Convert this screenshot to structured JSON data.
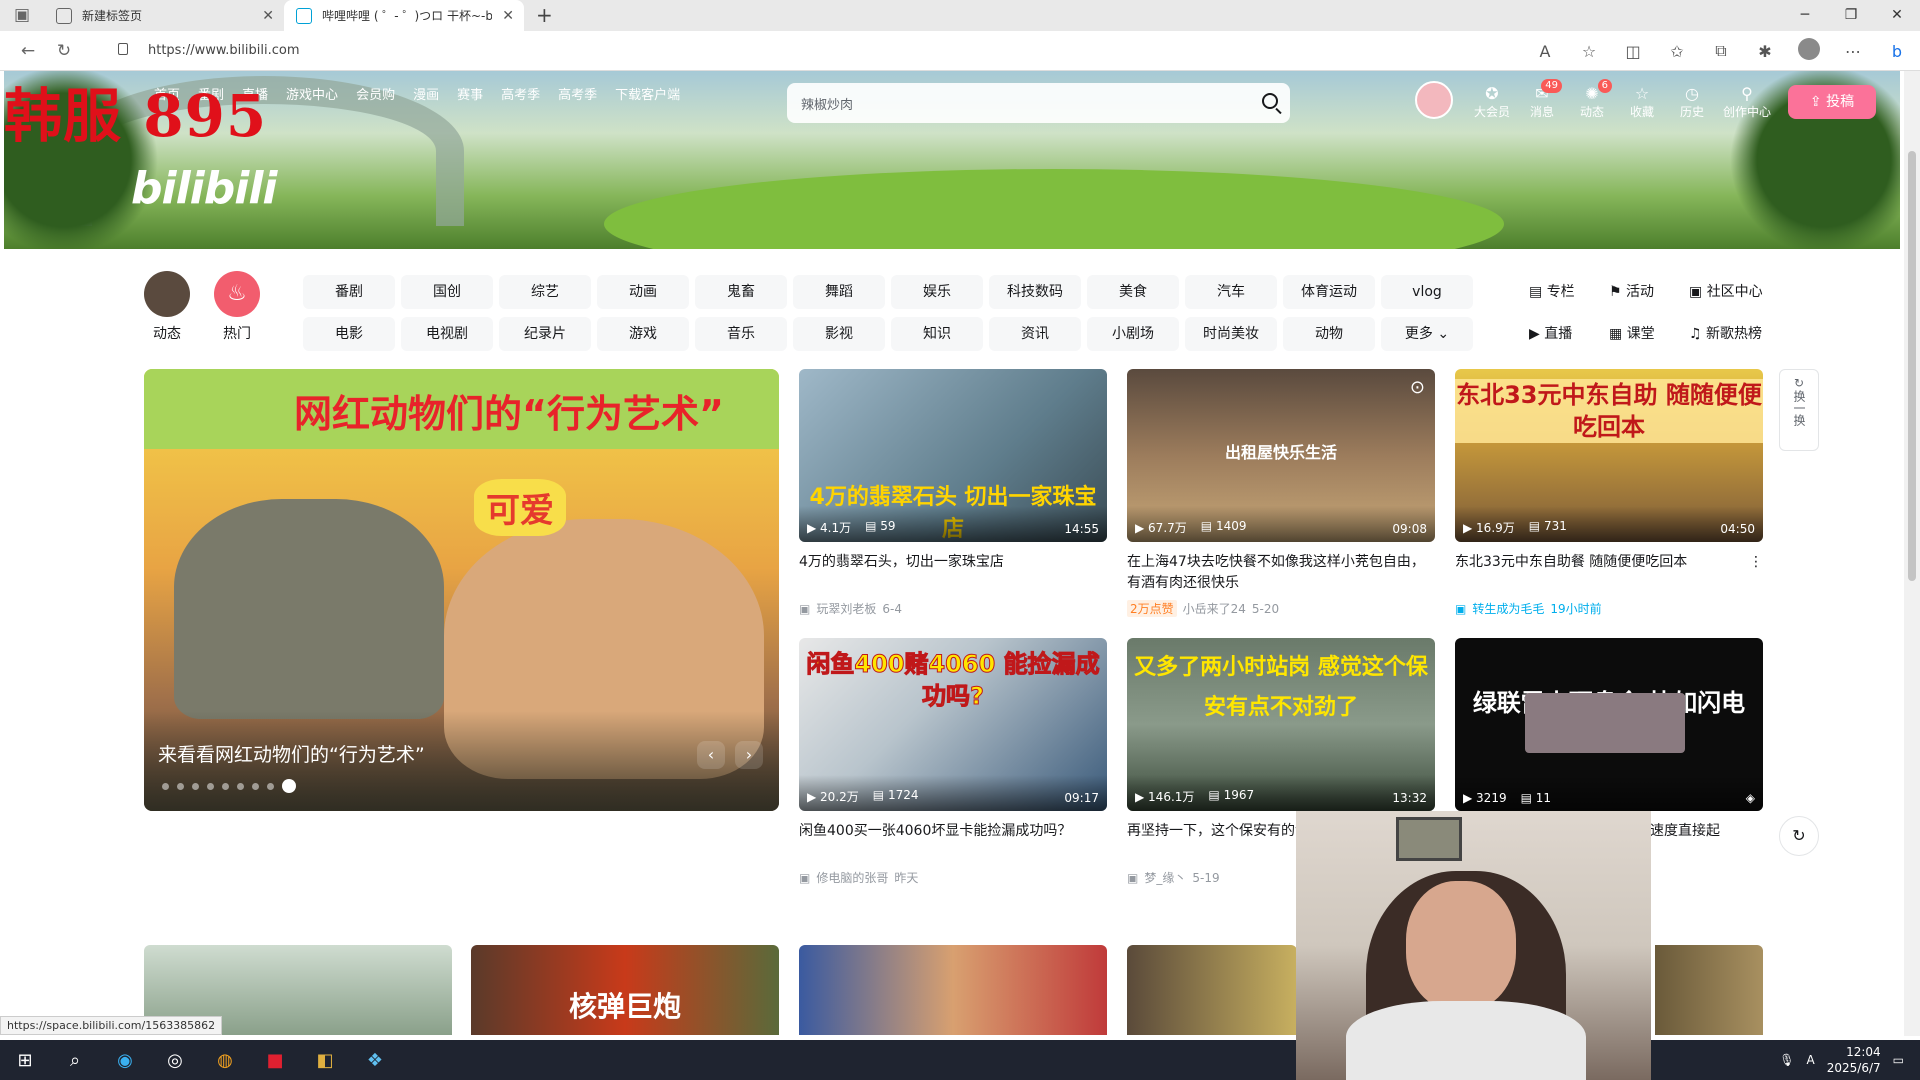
{
  "browser": {
    "tabs": [
      {
        "label": "新建标签页",
        "active": false
      },
      {
        "label": "哔哩哔哩 ( ゜- ゜)つロ 干杯~-bili",
        "active": true
      }
    ],
    "url": "https://www.bilibili.com",
    "status_url": "https://space.bilibili.com/1563385862"
  },
  "watermark": "韩服 895",
  "logo": "bilibili",
  "topnav": [
    "首页",
    "番剧",
    "直播",
    "游戏中心",
    "会员购",
    "漫画",
    "赛事",
    "高考季",
    "高考季",
    "下载客户端"
  ],
  "search": {
    "placeholder": "辣椒炒肉"
  },
  "user": {
    "items": [
      {
        "label": "大会员",
        "badge": ""
      },
      {
        "label": "消息",
        "badge": "49"
      },
      {
        "label": "动态",
        "badge": "6"
      },
      {
        "label": "收藏",
        "badge": ""
      },
      {
        "label": "历史",
        "badge": ""
      },
      {
        "label": "创作中心",
        "badge": ""
      }
    ],
    "upload": "投稿"
  },
  "quick": [
    {
      "label": "动态"
    },
    {
      "label": "热门"
    }
  ],
  "channels": [
    "番剧",
    "国创",
    "综艺",
    "动画",
    "鬼畜",
    "舞蹈",
    "娱乐",
    "科技数码",
    "美食",
    "汽车",
    "体育运动",
    "vlog",
    "电影",
    "电视剧",
    "纪录片",
    "游戏",
    "音乐",
    "影视",
    "知识",
    "资讯",
    "小剧场",
    "时尚美妆",
    "动物",
    "更多"
  ],
  "side_links": [
    "专栏",
    "活动",
    "社区中心",
    "直播",
    "课堂",
    "新歌热榜"
  ],
  "carousel": {
    "headline": "网红动物们的“行为艺术”",
    "cute": "可爱",
    "caption": "来看看网红动物们的“行为艺术”"
  },
  "refresh_label": "换一换",
  "videos": [
    {
      "thumb_text": "4万的翡翠石头 切出一家珠宝店",
      "views": "4.1万",
      "danmaku": "59",
      "duration": "14:55",
      "title": "4万的翡翠石头，切出一家珠宝店",
      "author": "玩翠刘老板",
      "date": "6-4",
      "tag": ""
    },
    {
      "thumb_text": "出租屋快乐生活",
      "views": "67.7万",
      "danmaku": "1409",
      "duration": "09:08",
      "title": "在上海47块去吃快餐不如像我这样小茺包自由，有酒有肉还很快乐",
      "author": "小岳来了24",
      "date": "5-20",
      "tag": "2万点赞"
    },
    {
      "thumb_text": "东北33元中东自助 随随便便吃回本",
      "views": "16.9万",
      "danmaku": "731",
      "duration": "04:50",
      "title": "东北33元中东自助餐 随随便便吃回本",
      "author": "转生成为毛毛",
      "date": "19小时前",
      "tag": ""
    },
    {
      "thumb_text": "闲鱼400赌4060 能捡漏成功吗?",
      "views": "20.2万",
      "danmaku": "1724",
      "duration": "09:17",
      "title": "闲鱼400买一张4060坏显卡能捡漏成功吗？",
      "author": "修电脑的张哥",
      "date": "昨天",
      "tag": ""
    },
    {
      "thumb_text": "又多了两小时站岗 感觉这个保安有点不对劲了",
      "views": "146.1万",
      "danmaku": "1967",
      "duration": "13:32",
      "title": "再坚持一下，这个保安有的领导开始搞事情了，又",
      "author": "梦_缘丶",
      "date": "5-19",
      "tag": ""
    },
    {
      "thumb_text": "绿联雷电硬盘盒 快如闪电",
      "views": "3219",
      "danmaku": "11",
      "duration": "",
      "title": "速度直接起",
      "author": "",
      "date": "",
      "tag": ""
    }
  ],
  "bottom_thumb_text": "核弹巨炮",
  "clock": {
    "time": "12:04",
    "date": "2025/6/7"
  }
}
